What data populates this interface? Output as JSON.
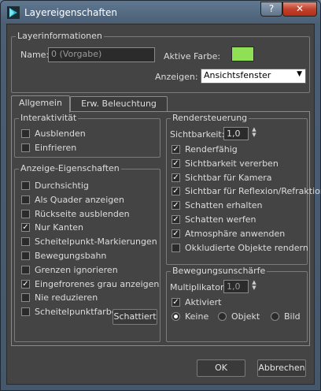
{
  "window": {
    "title": "Layereigenschaften",
    "help_label": "?",
    "close_label": "✕"
  },
  "layer_info": {
    "group_title": "Layerinformationen",
    "name_label": "Name:",
    "name_value": "0 (Vorgabe)",
    "color_label": "Aktive Farbe:",
    "active_color": "#8fe055",
    "display_label": "Anzeigen:",
    "display_value": "Ansichtsfenster"
  },
  "tabs": [
    {
      "label": "Allgemein",
      "active": true
    },
    {
      "label": "Erw. Beleuchtung",
      "active": false
    }
  ],
  "interactivity": {
    "group_title": "Interaktivität",
    "items": [
      {
        "label": "Ausblenden",
        "checked": false
      },
      {
        "label": "Einfrieren",
        "checked": false
      }
    ]
  },
  "display_props": {
    "group_title": "Anzeige-Eigenschaften",
    "items": [
      {
        "label": "Durchsichtig",
        "checked": false
      },
      {
        "label": "Als Quader anzeigen",
        "checked": false
      },
      {
        "label": "Rückseite ausblenden",
        "checked": false
      },
      {
        "label": "Nur Kanten",
        "checked": true
      },
      {
        "label": "Scheitelpunkt-Markierungen",
        "checked": false
      },
      {
        "label": "Bewegungsbahn",
        "checked": false
      },
      {
        "label": "Grenzen ignorieren",
        "checked": false
      },
      {
        "label": "Eingefrorenes grau anzeigen",
        "checked": true
      },
      {
        "label": "Nie reduzieren",
        "checked": false
      },
      {
        "label": "Scheitelpunktfarben",
        "checked": false
      }
    ],
    "shaded_button": "Schattiert"
  },
  "render_control": {
    "group_title": "Rendersteuerung",
    "visibility_label": "Sichtbarkeit:",
    "visibility_value": "1,0",
    "items": [
      {
        "label": "Renderfähig",
        "checked": true
      },
      {
        "label": "Sichtbarkeit vererben",
        "checked": true
      },
      {
        "label": "Sichtbar für Kamera",
        "checked": true
      },
      {
        "label": "Sichtbar für Reflexion/Refraktion",
        "checked": true
      },
      {
        "label": "Schatten erhalten",
        "checked": true
      },
      {
        "label": "Schatten werfen",
        "checked": true
      },
      {
        "label": "Atmosphäre anwenden",
        "checked": true
      },
      {
        "label": "Okkludierte Objekte rendern",
        "checked": false
      }
    ]
  },
  "motion_blur": {
    "group_title": "Bewegungsunschärfe",
    "multiplier_label": "Multiplikator:",
    "multiplier_value": "1,0",
    "enabled_label": "Aktiviert",
    "enabled": true,
    "options": [
      {
        "label": "Keine",
        "selected": true
      },
      {
        "label": "Objekt",
        "selected": false
      },
      {
        "label": "Bild",
        "selected": false
      }
    ]
  },
  "footer": {
    "ok_label": "OK",
    "cancel_label": "Abbrechen"
  }
}
